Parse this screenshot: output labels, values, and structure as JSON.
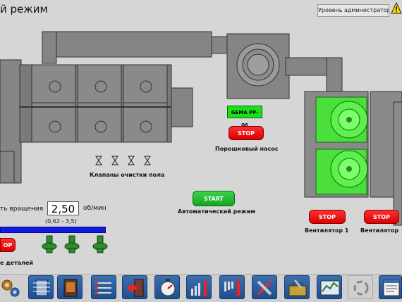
{
  "header": {
    "title": "й режим",
    "user_level": "Уровень администратор"
  },
  "equipment": {
    "valves_label": "Клапаны очистки пола",
    "pump_label": "Порошковый насос",
    "gema_label": "GEMA PP-06",
    "pump_stop": "STOP",
    "fan1_label": "Вентилятор 1",
    "fan2_label": "Вентилятор",
    "fan1_stop": "STOP",
    "fan2_stop": "STOP"
  },
  "auto": {
    "start_label": "START",
    "mode_label": "Автоматический режим"
  },
  "conveyor": {
    "speed_label": "ть вращения",
    "speed_value": "2,50",
    "speed_unit": "об/мин",
    "speed_range": "(0,62 - 3,5)",
    "stop_label": "OP",
    "parts_label": "е деталей"
  },
  "toolbar": {
    "icons": [
      "gears-icon",
      "cooling-unit-icon",
      "oven-icon",
      "heater-icon",
      "exit-door-icon",
      "timer-icon",
      "temperature-up-icon",
      "temperature-down-icon",
      "tools-icon",
      "toolbox-icon",
      "trend-chart-icon",
      "cycle-icon",
      "report-icon"
    ]
  },
  "colors": {
    "accent_green": "#19e019",
    "stop_red": "#e60000",
    "toolbar_blue": "#2a5da0",
    "conveyor_blue": "#1218e8"
  }
}
